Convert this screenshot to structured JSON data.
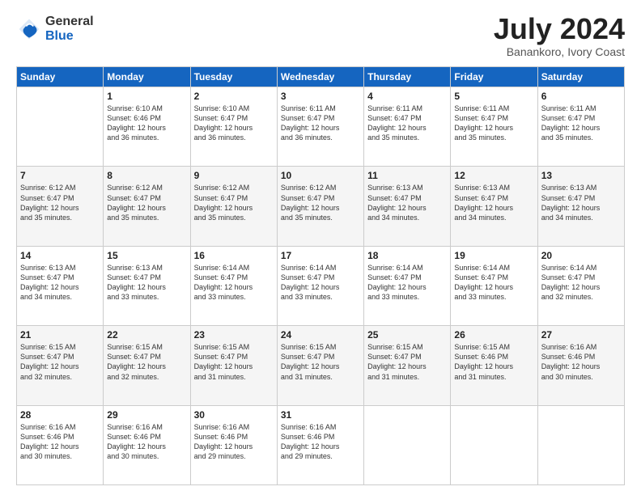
{
  "header": {
    "logo_general": "General",
    "logo_blue": "Blue",
    "month_year": "July 2024",
    "location": "Banankoro, Ivory Coast"
  },
  "weekdays": [
    "Sunday",
    "Monday",
    "Tuesday",
    "Wednesday",
    "Thursday",
    "Friday",
    "Saturday"
  ],
  "weeks": [
    [
      {
        "day": "",
        "info": ""
      },
      {
        "day": "1",
        "info": "Sunrise: 6:10 AM\nSunset: 6:46 PM\nDaylight: 12 hours\nand 36 minutes."
      },
      {
        "day": "2",
        "info": "Sunrise: 6:10 AM\nSunset: 6:47 PM\nDaylight: 12 hours\nand 36 minutes."
      },
      {
        "day": "3",
        "info": "Sunrise: 6:11 AM\nSunset: 6:47 PM\nDaylight: 12 hours\nand 36 minutes."
      },
      {
        "day": "4",
        "info": "Sunrise: 6:11 AM\nSunset: 6:47 PM\nDaylight: 12 hours\nand 35 minutes."
      },
      {
        "day": "5",
        "info": "Sunrise: 6:11 AM\nSunset: 6:47 PM\nDaylight: 12 hours\nand 35 minutes."
      },
      {
        "day": "6",
        "info": "Sunrise: 6:11 AM\nSunset: 6:47 PM\nDaylight: 12 hours\nand 35 minutes."
      }
    ],
    [
      {
        "day": "7",
        "info": "Sunrise: 6:12 AM\nSunset: 6:47 PM\nDaylight: 12 hours\nand 35 minutes."
      },
      {
        "day": "8",
        "info": "Sunrise: 6:12 AM\nSunset: 6:47 PM\nDaylight: 12 hours\nand 35 minutes."
      },
      {
        "day": "9",
        "info": "Sunrise: 6:12 AM\nSunset: 6:47 PM\nDaylight: 12 hours\nand 35 minutes."
      },
      {
        "day": "10",
        "info": "Sunrise: 6:12 AM\nSunset: 6:47 PM\nDaylight: 12 hours\nand 35 minutes."
      },
      {
        "day": "11",
        "info": "Sunrise: 6:13 AM\nSunset: 6:47 PM\nDaylight: 12 hours\nand 34 minutes."
      },
      {
        "day": "12",
        "info": "Sunrise: 6:13 AM\nSunset: 6:47 PM\nDaylight: 12 hours\nand 34 minutes."
      },
      {
        "day": "13",
        "info": "Sunrise: 6:13 AM\nSunset: 6:47 PM\nDaylight: 12 hours\nand 34 minutes."
      }
    ],
    [
      {
        "day": "14",
        "info": "Sunrise: 6:13 AM\nSunset: 6:47 PM\nDaylight: 12 hours\nand 34 minutes."
      },
      {
        "day": "15",
        "info": "Sunrise: 6:13 AM\nSunset: 6:47 PM\nDaylight: 12 hours\nand 33 minutes."
      },
      {
        "day": "16",
        "info": "Sunrise: 6:14 AM\nSunset: 6:47 PM\nDaylight: 12 hours\nand 33 minutes."
      },
      {
        "day": "17",
        "info": "Sunrise: 6:14 AM\nSunset: 6:47 PM\nDaylight: 12 hours\nand 33 minutes."
      },
      {
        "day": "18",
        "info": "Sunrise: 6:14 AM\nSunset: 6:47 PM\nDaylight: 12 hours\nand 33 minutes."
      },
      {
        "day": "19",
        "info": "Sunrise: 6:14 AM\nSunset: 6:47 PM\nDaylight: 12 hours\nand 33 minutes."
      },
      {
        "day": "20",
        "info": "Sunrise: 6:14 AM\nSunset: 6:47 PM\nDaylight: 12 hours\nand 32 minutes."
      }
    ],
    [
      {
        "day": "21",
        "info": "Sunrise: 6:15 AM\nSunset: 6:47 PM\nDaylight: 12 hours\nand 32 minutes."
      },
      {
        "day": "22",
        "info": "Sunrise: 6:15 AM\nSunset: 6:47 PM\nDaylight: 12 hours\nand 32 minutes."
      },
      {
        "day": "23",
        "info": "Sunrise: 6:15 AM\nSunset: 6:47 PM\nDaylight: 12 hours\nand 31 minutes."
      },
      {
        "day": "24",
        "info": "Sunrise: 6:15 AM\nSunset: 6:47 PM\nDaylight: 12 hours\nand 31 minutes."
      },
      {
        "day": "25",
        "info": "Sunrise: 6:15 AM\nSunset: 6:47 PM\nDaylight: 12 hours\nand 31 minutes."
      },
      {
        "day": "26",
        "info": "Sunrise: 6:15 AM\nSunset: 6:46 PM\nDaylight: 12 hours\nand 31 minutes."
      },
      {
        "day": "27",
        "info": "Sunrise: 6:16 AM\nSunset: 6:46 PM\nDaylight: 12 hours\nand 30 minutes."
      }
    ],
    [
      {
        "day": "28",
        "info": "Sunrise: 6:16 AM\nSunset: 6:46 PM\nDaylight: 12 hours\nand 30 minutes."
      },
      {
        "day": "29",
        "info": "Sunrise: 6:16 AM\nSunset: 6:46 PM\nDaylight: 12 hours\nand 30 minutes."
      },
      {
        "day": "30",
        "info": "Sunrise: 6:16 AM\nSunset: 6:46 PM\nDaylight: 12 hours\nand 29 minutes."
      },
      {
        "day": "31",
        "info": "Sunrise: 6:16 AM\nSunset: 6:46 PM\nDaylight: 12 hours\nand 29 minutes."
      },
      {
        "day": "",
        "info": ""
      },
      {
        "day": "",
        "info": ""
      },
      {
        "day": "",
        "info": ""
      }
    ]
  ]
}
